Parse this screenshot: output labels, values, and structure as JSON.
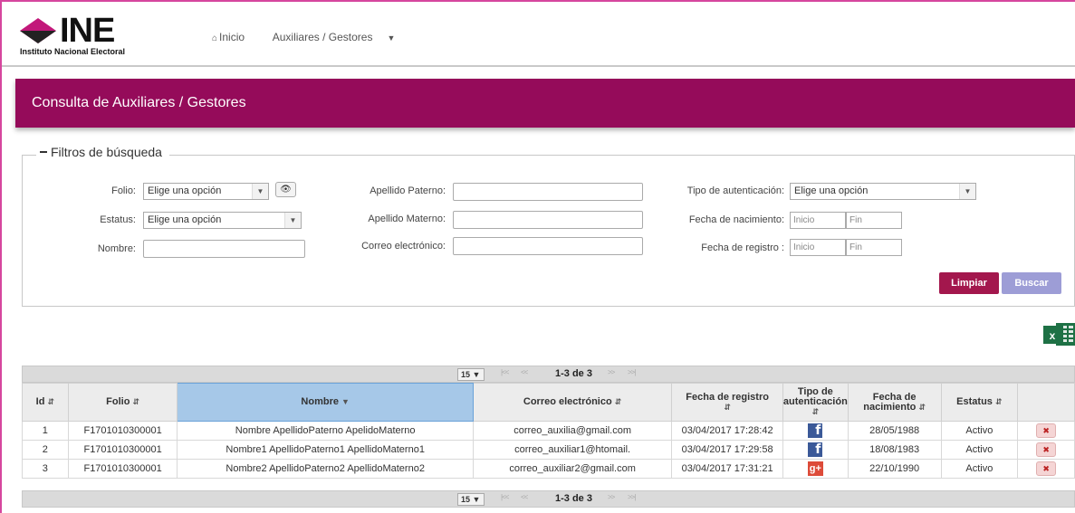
{
  "header": {
    "logo_text": "INE",
    "logo_subtitle": "Instituto Nacional Electoral",
    "nav": {
      "home_label": "Inicio",
      "menu_label": "Auxiliares / Gestores"
    }
  },
  "page": {
    "title": "Consulta de Auxiliares / Gestores"
  },
  "filters": {
    "legend": "Filtros de búsqueda",
    "folio_label": "Folio:",
    "folio_value": "Elige una opción",
    "estatus_label": "Estatus:",
    "estatus_value": "Elige una opción",
    "nombre_label": "Nombre:",
    "nombre_value": "",
    "apellido_paterno_label": "Apellido Paterno:",
    "apellido_materno_label": "Apellido Materno:",
    "correo_label": "Correo electrónico:",
    "tipo_auth_label": "Tipo de autenticación:",
    "tipo_auth_value": "Elige una opción",
    "fecha_nac_label": "Fecha de nacimiento:",
    "fecha_reg_label": "Fecha de registro :",
    "inicio_placeholder": "Inicio",
    "fin_placeholder": "Fin",
    "limpiar_label": "Limpiar",
    "buscar_label": "Buscar"
  },
  "pager": {
    "page_size": "15",
    "count": "1-3 de 3"
  },
  "table": {
    "columns": {
      "id": "Id",
      "folio": "Folio",
      "nombre": "Nombre",
      "correo": "Correo electrónico",
      "fecha_registro": "Fecha de registro",
      "tipo_auth_1": "Tipo de",
      "tipo_auth_2": "autenticación",
      "fecha_nac_1": "Fecha de",
      "fecha_nac_2": "nacimiento",
      "estatus": "Estatus"
    },
    "rows": [
      {
        "id": "1",
        "folio": "F1701010300001",
        "nombre": "Nombre ApellidoPaterno ApelidoMaterno",
        "correo": "correo_auxilia@gmail.com",
        "fecha_registro": "03/04/2017 17:28:42",
        "auth": "facebook",
        "fecha_nac": "28/05/1988",
        "estatus": "Activo"
      },
      {
        "id": "2",
        "folio": "F1701010300001",
        "nombre": "Nombre1 ApellidoPaterno1 ApellidoMaterno1",
        "correo": "correo_auxiliar1@htomail.",
        "fecha_registro": "03/04/2017 17:29:58",
        "auth": "facebook",
        "fecha_nac": "18/08/1983",
        "estatus": "Activo"
      },
      {
        "id": "3",
        "folio": "F1701010300001",
        "nombre": "Nombre2 ApellidoPaterno2 ApellidoMaterno2",
        "correo": "correo_auxiliar2@gmail.com",
        "fecha_registro": "03/04/2017 17:31:21",
        "auth": "google-plus",
        "fecha_nac": "22/10/1990",
        "estatus": "Activo"
      }
    ]
  },
  "colors": {
    "brand": "#950b5a",
    "limpiar": "#a3174d",
    "buscar": "#9d9dd6",
    "frame": "#d6469e"
  }
}
